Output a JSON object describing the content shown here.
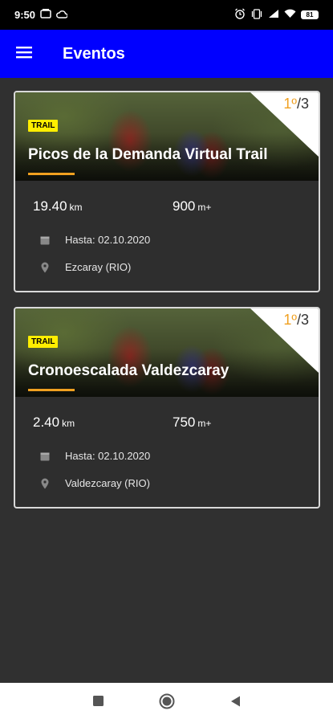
{
  "status": {
    "time": "9:50",
    "battery": "81",
    "left_icons": [
      "gallery-icon",
      "cloud-icon"
    ],
    "right_icons": [
      "alarm-icon",
      "vibrate-icon",
      "signal-icon",
      "wifi-icon",
      "battery-icon"
    ]
  },
  "appbar": {
    "title": "Eventos",
    "color": "#0000ff"
  },
  "events": [
    {
      "badge": "TRAIL",
      "title": "Picos de la Demanda Virtual Trail",
      "position": "1º",
      "total": "/3",
      "distance": "19.40",
      "distance_unit": "km",
      "elevation": "900",
      "elevation_unit": "m+",
      "deadline": "Hasta: 02.10.2020",
      "location": "Ezcaray (RIO)"
    },
    {
      "badge": "TRAIL",
      "title": "Cronoescalada Valdezcaray",
      "position": "1º",
      "total": "/3",
      "distance": "2.40",
      "distance_unit": "km",
      "elevation": "750",
      "elevation_unit": "m+",
      "deadline": "Hasta: 02.10.2020",
      "location": "Valdezcaray (RIO)"
    }
  ],
  "colors": {
    "accent": "#f0a020",
    "badge": "#ffee00",
    "background": "#303030"
  },
  "navbar": {
    "icons": [
      "recents-square-icon",
      "home-circle-icon",
      "back-triangle-icon"
    ]
  }
}
